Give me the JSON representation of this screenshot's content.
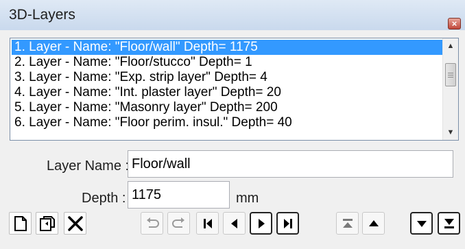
{
  "window": {
    "title": "3D-Layers",
    "close_glyph": "×"
  },
  "layers": {
    "items": [
      "1. Layer - Name: \"Floor/wall\" Depth= 1175",
      "2. Layer - Name: \"Floor/stucco\" Depth= 1",
      "3. Layer - Name: \"Exp. strip layer\" Depth= 4",
      "4. Layer - Name: \"Int. plaster layer\" Depth= 20",
      "5. Layer - Name: \"Masonry layer\" Depth= 200",
      "6. Layer - Name: \"Floor perim. insul.\" Depth= 40"
    ],
    "selected_index": 0
  },
  "form": {
    "layer_name_label": "Layer Name :",
    "layer_name_value": "Floor/wall",
    "depth_label": "Depth :",
    "depth_value": "1175",
    "depth_unit": "mm"
  },
  "toolbar": {
    "icons": [
      "new-layer-icon",
      "copy-layer-icon",
      "delete-layer-icon",
      "undo-icon",
      "redo-icon",
      "first-icon",
      "previous-icon",
      "next-icon",
      "last-icon",
      "move-top-icon",
      "move-up-icon",
      "move-down-icon",
      "move-bottom-icon"
    ]
  },
  "colors": {
    "selection": "#3399ff",
    "close_button": "#c0473a"
  }
}
